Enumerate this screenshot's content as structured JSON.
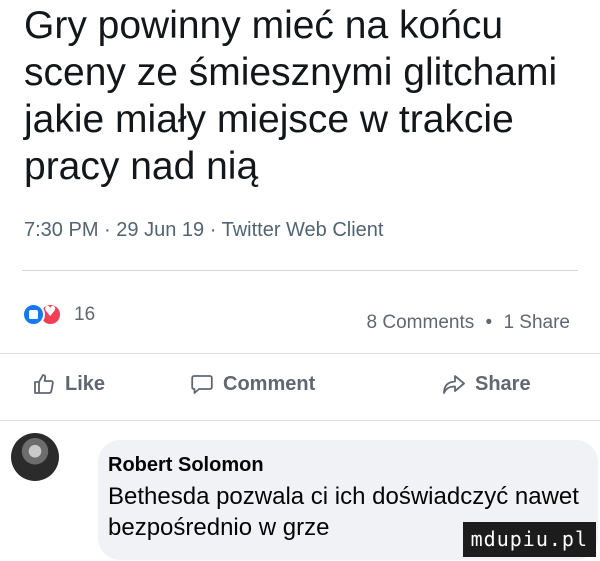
{
  "tweet": {
    "text": "Gry powinny mieć na końcu sceny ze śmiesznymi glitchami jakie miały miejsce w trakcie pracy nad nią",
    "time": "7:30 PM",
    "date": "29 Jun 19",
    "source": "Twitter Web Client",
    "separator": "·"
  },
  "reactions": {
    "icons": [
      "like-icon",
      "love-icon"
    ],
    "count": "16"
  },
  "engagement": {
    "comments": "8 Comments",
    "separator": "•",
    "shares": "1 Share"
  },
  "actions": {
    "like_label": "Like",
    "comment_label": "Comment",
    "share_label": "Share"
  },
  "comment": {
    "author": "Robert Solomon",
    "text": "Bethesda pozwala ci ich doświadczyć nawet bezpośrednio w grze"
  },
  "watermark": "mdupiu.pl",
  "colors": {
    "like_blue": "#1877f2",
    "love_red": "#f33e58",
    "meta_gray": "#536471",
    "bubble_bg": "#f0f2f5"
  }
}
